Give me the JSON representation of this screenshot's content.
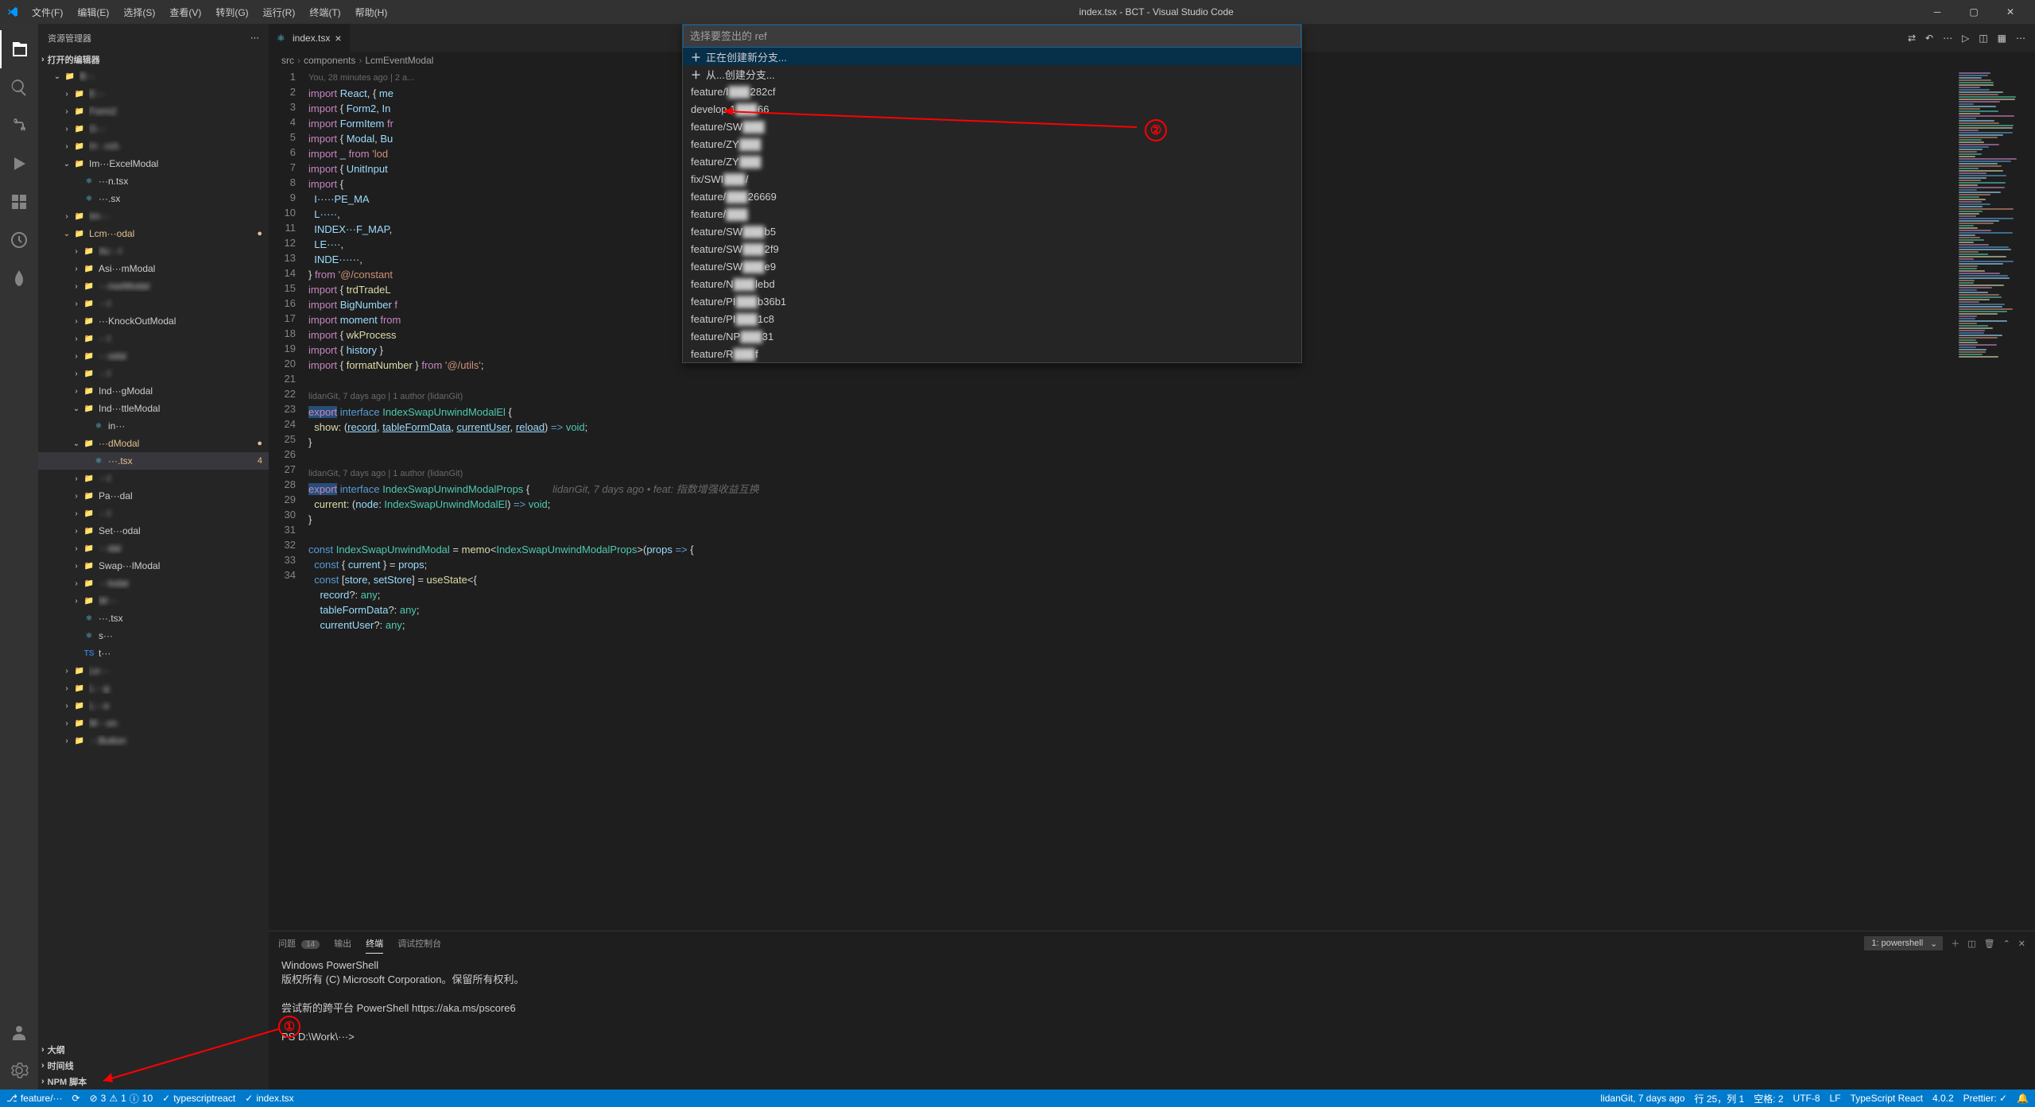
{
  "window": {
    "title": "index.tsx - BCT - Visual Studio Code"
  },
  "menu": [
    {
      "label": "文件(F)"
    },
    {
      "label": "编辑(E)"
    },
    {
      "label": "选择(S)"
    },
    {
      "label": "查看(V)"
    },
    {
      "label": "转到(G)"
    },
    {
      "label": "运行(R)"
    },
    {
      "label": "终端(T)"
    },
    {
      "label": "帮助(H)"
    }
  ],
  "sidebar": {
    "title": "资源管理器",
    "openEditors": "打开的编辑器",
    "outline": "大纲",
    "timeline": "时间线",
    "npmScripts": "NPM 脚本"
  },
  "tree": [
    {
      "depth": 1,
      "type": "folder",
      "open": true,
      "label": "B···",
      "blur": true
    },
    {
      "depth": 2,
      "type": "folder",
      "open": false,
      "label": "E···",
      "blur": true
    },
    {
      "depth": 2,
      "type": "folder",
      "open": false,
      "label": "Form2",
      "blur": true
    },
    {
      "depth": 2,
      "type": "folder",
      "open": false,
      "label": "G···",
      "blur": true
    },
    {
      "depth": 2,
      "type": "folder",
      "open": false,
      "label": "H···rch",
      "blur": true
    },
    {
      "depth": 2,
      "type": "folder",
      "open": true,
      "label": "Im···ExcelModal"
    },
    {
      "depth": 3,
      "type": "file",
      "label": "···n.tsx",
      "icon": "ts"
    },
    {
      "depth": 3,
      "type": "file",
      "label": "···.sx",
      "icon": "ts"
    },
    {
      "depth": 2,
      "type": "folder",
      "open": false,
      "label": "Im···",
      "blur": true
    },
    {
      "depth": 2,
      "type": "folder",
      "open": true,
      "label": "Lcm···odal",
      "modified": true,
      "dot": true
    },
    {
      "depth": 3,
      "type": "folder",
      "open": false,
      "label": "Ac···l",
      "blur": true
    },
    {
      "depth": 3,
      "type": "folder",
      "open": false,
      "label": "Asi···mModal"
    },
    {
      "depth": 3,
      "type": "folder",
      "open": false,
      "label": "···nseModal",
      "blur": true
    },
    {
      "depth": 3,
      "type": "folder",
      "open": false,
      "label": "···l",
      "blur": true
    },
    {
      "depth": 3,
      "type": "folder",
      "open": false,
      "label": "···KnockOutModal"
    },
    {
      "depth": 3,
      "type": "folder",
      "open": false,
      "label": "···l",
      "blur": true
    },
    {
      "depth": 3,
      "type": "folder",
      "open": false,
      "label": "···odal",
      "blur": true
    },
    {
      "depth": 3,
      "type": "folder",
      "open": false,
      "label": "···l",
      "blur": true
    },
    {
      "depth": 3,
      "type": "folder",
      "open": false,
      "label": "Ind···gModal"
    },
    {
      "depth": 3,
      "type": "folder",
      "open": true,
      "label": "Ind···ttleModal"
    },
    {
      "depth": 4,
      "type": "file",
      "label": "in···",
      "icon": "ts"
    },
    {
      "depth": 3,
      "type": "folder",
      "open": true,
      "label": "···dModal",
      "modified": true,
      "dot": true
    },
    {
      "depth": 4,
      "type": "file",
      "label": "···.tsx",
      "icon": "ts",
      "selected": true,
      "modified": true,
      "badge": "4"
    },
    {
      "depth": 3,
      "type": "folder",
      "open": false,
      "label": "···l",
      "blur": true
    },
    {
      "depth": 3,
      "type": "folder",
      "open": false,
      "label": "Pa···dal"
    },
    {
      "depth": 3,
      "type": "folder",
      "open": false,
      "label": "···l",
      "blur": true
    },
    {
      "depth": 3,
      "type": "folder",
      "open": false,
      "label": "Set···odal"
    },
    {
      "depth": 3,
      "type": "folder",
      "open": false,
      "label": "···dal",
      "blur": true
    },
    {
      "depth": 3,
      "type": "folder",
      "open": false,
      "label": "Swap···lModal"
    },
    {
      "depth": 3,
      "type": "folder",
      "open": false,
      "label": "···lodal",
      "blur": true
    },
    {
      "depth": 3,
      "type": "folder",
      "open": false,
      "label": "W···",
      "blur": true
    },
    {
      "depth": 3,
      "type": "file",
      "label": "···.tsx",
      "icon": "ts"
    },
    {
      "depth": 3,
      "type": "file",
      "label": "s···",
      "icon": "ts"
    },
    {
      "depth": 3,
      "type": "file",
      "label": "t···",
      "icon": "ts",
      "tsicon": true
    },
    {
      "depth": 2,
      "type": "folder",
      "open": false,
      "label": "Le···",
      "blur": true
    },
    {
      "depth": 2,
      "type": "folder",
      "open": false,
      "label": "L···g",
      "blur": true
    },
    {
      "depth": 2,
      "type": "folder",
      "open": false,
      "label": "L···e",
      "blur": true
    },
    {
      "depth": 2,
      "type": "folder",
      "open": false,
      "label": "M···on",
      "blur": true
    },
    {
      "depth": 2,
      "type": "folder",
      "open": false,
      "label": "···Button",
      "blur": true
    }
  ],
  "tab": {
    "name": "index.tsx"
  },
  "breadcrumbs": [
    "src",
    "components",
    "LcmEventModal",
    "..."
  ],
  "authorTop": "You, 28 minutes ago | 2 a...",
  "author2": "lidanGit, 7 days ago | 1 author (lidanGit)",
  "author3": "lidanGit, 7 days ago | 1 author (lidanGit)",
  "inlineHint": "lidanGit, 7 days ago • feat: 指数增强收益互换",
  "quickpick": {
    "placeholder": "选择要签出的 ref",
    "items": [
      {
        "plus": true,
        "label": "正在创建新分支...",
        "selected": true
      },
      {
        "plus": true,
        "label": "从...创建分支..."
      },
      {
        "label": "feature/l···282cf",
        "hash": true
      },
      {
        "label": "develop  1···66",
        "hash": true
      },
      {
        "label": "feature/SW···",
        "hash": true
      },
      {
        "label": "feature/ZY···",
        "hash": true
      },
      {
        "label": "feature/ZY···",
        "hash": true
      },
      {
        "label": "fix/SWI···/",
        "hash": true
      },
      {
        "label": "feature/···26669",
        "hash": true
      },
      {
        "label": "feature/···",
        "hash": true
      },
      {
        "label": "feature/SW···b5",
        "hash": true
      },
      {
        "label": "feature/SW···2f9",
        "hash": true
      },
      {
        "label": "feature/SW···e9",
        "hash": true
      },
      {
        "label": "feature/N···lebd",
        "hash": true
      },
      {
        "label": "feature/PI···b36b1",
        "hash": true
      },
      {
        "label": "feature/PI···1c8",
        "hash": true
      },
      {
        "label": "feature/NP···31",
        "hash": true
      },
      {
        "label": "feature/R···f",
        "hash": true
      }
    ]
  },
  "panel": {
    "tabs": {
      "problems": "问题",
      "problemsCount": "14",
      "output": "输出",
      "terminal": "终端",
      "debug": "调试控制台"
    },
    "terminalName": "1: powershell",
    "content": [
      "Windows PowerShell",
      "版权所有 (C) Microsoft Corporation。保留所有权利。",
      "",
      "尝试新的跨平台 PowerShell https://aka.ms/pscore6",
      "",
      "PS D:\\Work\\···>"
    ]
  },
  "statusbar": {
    "branch": "feature/···",
    "errors": "3",
    "warnings": "1",
    "info": "10",
    "tsreact": "typescriptreact",
    "filename": "index.tsx",
    "gitAuthor": "lidanGit, 7 days ago",
    "lineCol": "行 25，列 1",
    "spaces": "空格: 2",
    "encoding": "UTF-8",
    "eol": "LF",
    "lang": "TypeScript React",
    "version": "4.0.2",
    "prettier": "Prettier: ✓",
    "bell": "🔔"
  }
}
